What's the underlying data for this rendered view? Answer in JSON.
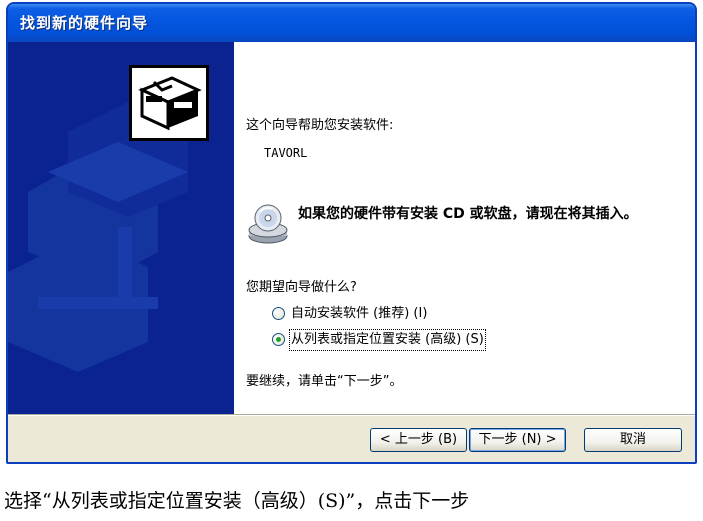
{
  "window": {
    "title": "找到新的硬件向导"
  },
  "content": {
    "intro": "这个向导帮助您安装软件:",
    "device_name": "TAVORL",
    "cd_prompt": "如果您的硬件带有安装 CD 或软盘，请现在将其插入。",
    "question": "您期望向导做什么?",
    "options": [
      {
        "label": "自动安装软件 (推荐) (I)",
        "checked": false
      },
      {
        "label": "从列表或指定位置安装 (高级) (S)",
        "checked": true
      }
    ],
    "continue_text": "要继续，请单击“下一步”。"
  },
  "buttons": {
    "back": "< 上一步 (B)",
    "next": "下一步 (N) >",
    "cancel": "取消"
  },
  "caption": "选择“从列表或指定位置安装（高级）(S)”，点击下一步",
  "colors": {
    "titlebar": "#0456e0",
    "side_panel": "#0a2390",
    "dialog_bg": "#ece9d8",
    "radio_dot": "#24a020"
  },
  "icons": {
    "hardware": "hardware-icon",
    "cd": "cd-icon"
  }
}
